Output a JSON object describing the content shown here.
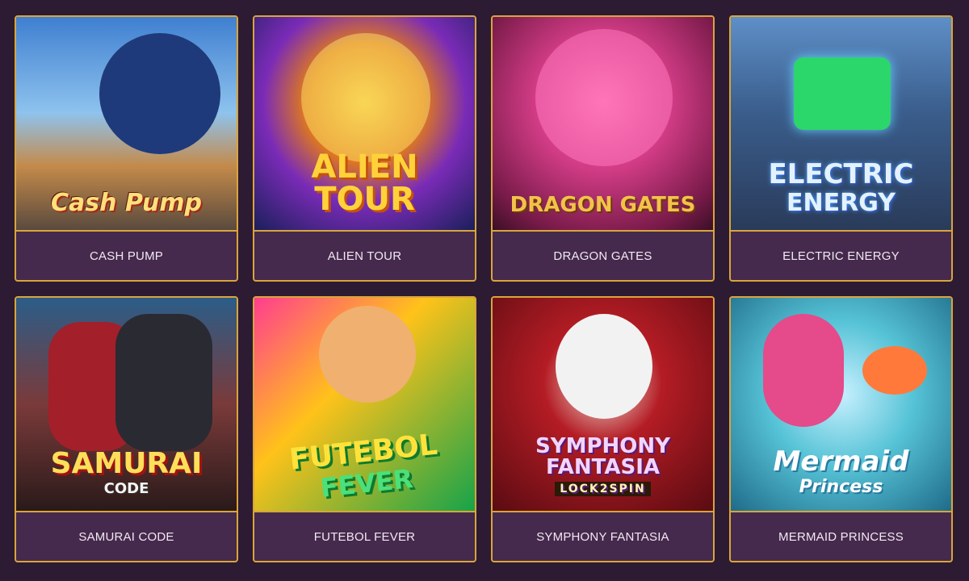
{
  "games": [
    {
      "label": "CASH PUMP",
      "art_title": "Cash Pump",
      "art_sub": ""
    },
    {
      "label": "ALIEN TOUR",
      "art_title": "ALIEN TOUR",
      "art_sub": ""
    },
    {
      "label": "DRAGON GATES",
      "art_title": "DRAGON GATES",
      "art_sub": ""
    },
    {
      "label": "ELECTRIC ENERGY",
      "art_title": "ELECTRIC",
      "art_sub": "ENERGY"
    },
    {
      "label": "SAMURAI CODE",
      "art_title": "SAMURAI",
      "art_sub": "CODE"
    },
    {
      "label": "FUTEBOL FEVER",
      "art_title": "FUTEBOL",
      "art_sub": "FEVER"
    },
    {
      "label": "SYMPHONY FANTASIA",
      "art_title": "SYMPHONY FANTASIA",
      "art_sub": "LOCK2SPIN"
    },
    {
      "label": "MERMAID PRINCESS",
      "art_title": "Mermaid",
      "art_sub": "Princess"
    }
  ],
  "colors": {
    "page_background": "#2d1a33",
    "card_background": "#452a4d",
    "card_border": "#d9a53a",
    "label_text": "#f2e8f2"
  }
}
